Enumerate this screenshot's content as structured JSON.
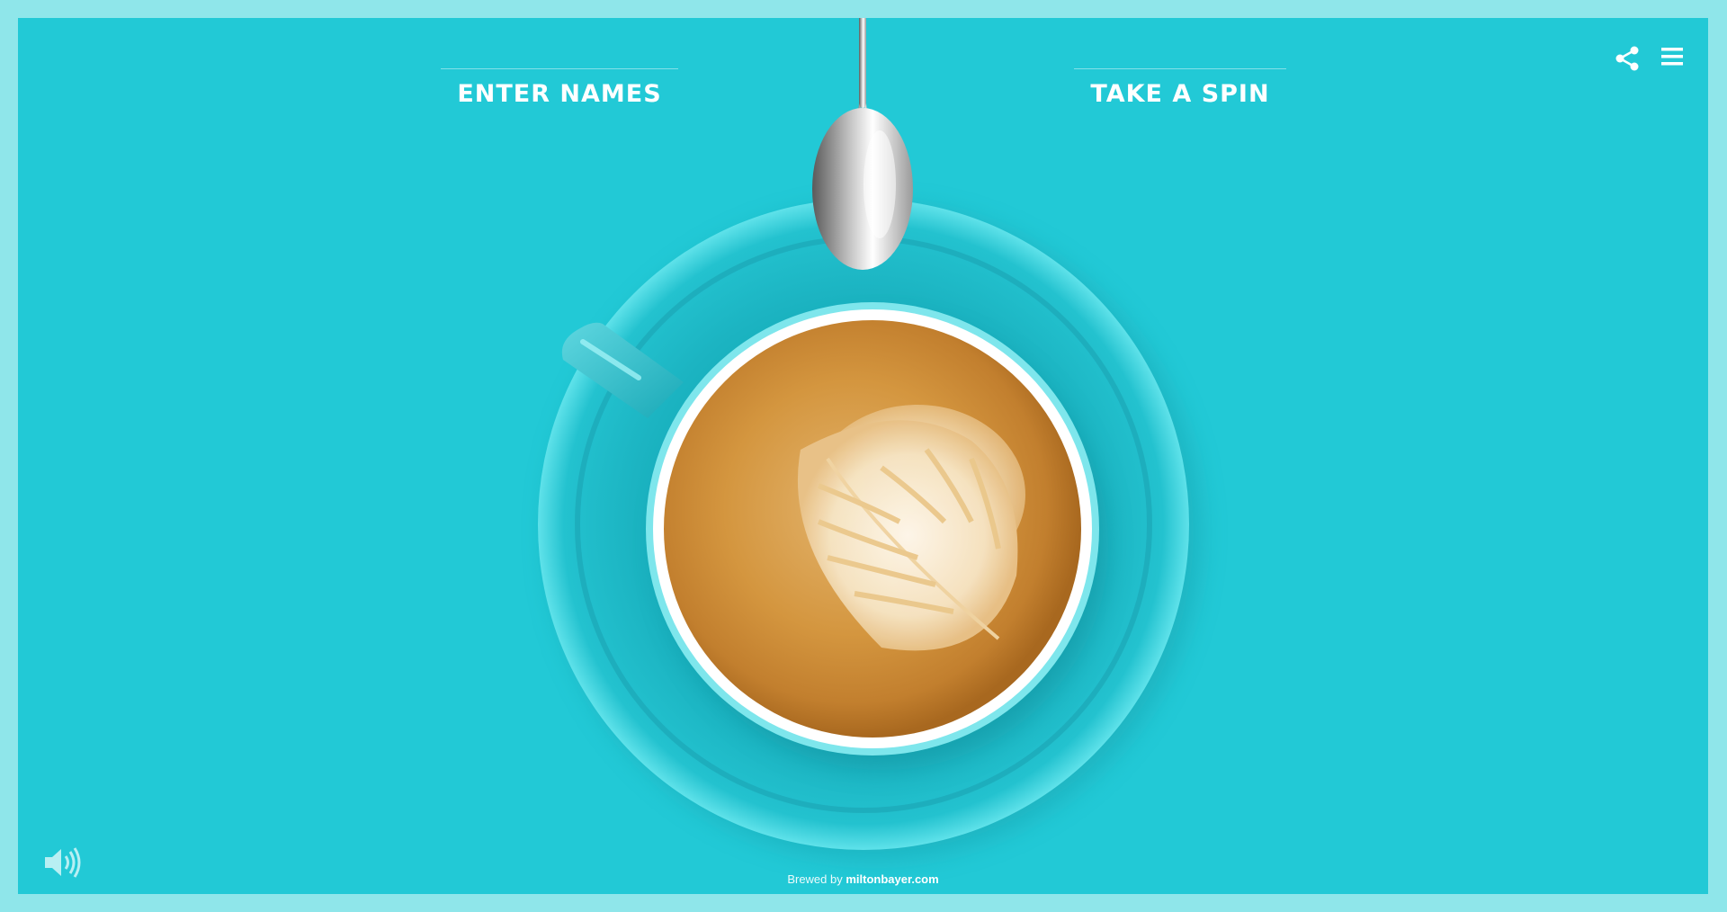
{
  "nav": {
    "enter_names": "ENTER NAMES",
    "take_a_spin": "TAKE A SPIN"
  },
  "icons": {
    "share": "share-icon",
    "menu": "hamburger-menu-icon",
    "sound": "speaker-volume-icon"
  },
  "footer": {
    "prefix": "Brewed by",
    "site": "miltonbayer.com"
  },
  "colors": {
    "frame": "#8fe6ea",
    "background": "#22c9d6",
    "text": "#ffffff"
  }
}
